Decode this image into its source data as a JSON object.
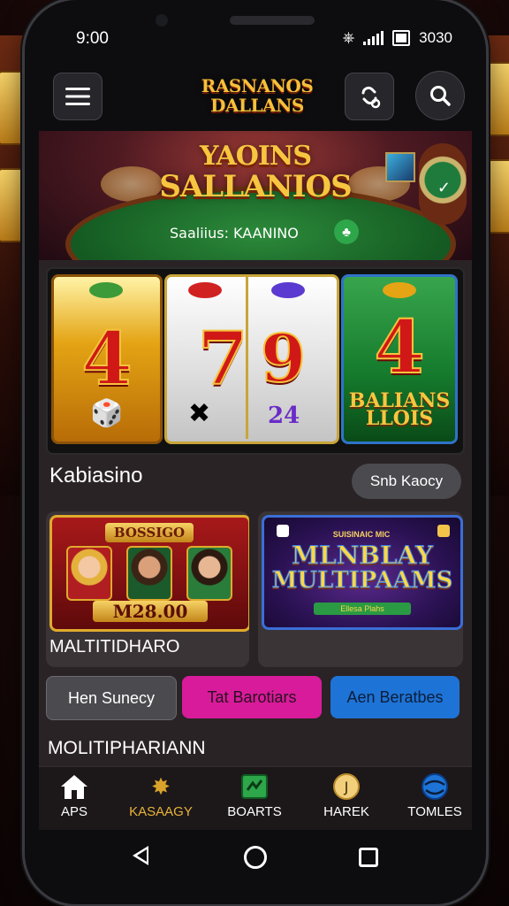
{
  "status": {
    "time": "9:00",
    "right_text": "3030"
  },
  "header": {
    "logo_line1": "RASNANOS",
    "logo_line2": "DALLANS"
  },
  "banner": {
    "title_line1": "YAOINS",
    "title_line2": "SALLANIOS",
    "subtitle": "Saaliius: KAANINO"
  },
  "slots": {
    "reel1": "4",
    "reel2": "7",
    "reel3": "9",
    "reel3_sub": "24",
    "reel4": "4",
    "reel4_label_line1": "BALIANS",
    "reel4_label_line2": "LLOIS"
  },
  "section": {
    "title": "Kabiasino",
    "button": "Snb Kaocy"
  },
  "cards": [
    {
      "badge": "BOSSIGO",
      "amount": "M28.00",
      "label": "MALTITIDHARO"
    },
    {
      "small": "SUISINAIC MIC",
      "line1": "MLNBLAY",
      "line2": "MULTIPAAMS",
      "bar": "Ellesa Plahs"
    }
  ],
  "buttons": [
    "Hen Sunecy",
    "Tat Barotiars",
    "Aen Beratbes"
  ],
  "section2": {
    "title": "MOLITIPHARIANN"
  },
  "tabs": [
    {
      "label": "APS",
      "icon": "home-icon"
    },
    {
      "label": "KASAAGY",
      "icon": "star-icon"
    },
    {
      "label": "BOARTS",
      "icon": "board-icon"
    },
    {
      "label": "HAREK",
      "icon": "coin-icon"
    },
    {
      "label": "TOMLES",
      "icon": "globe-icon"
    }
  ],
  "colors": {
    "accent_gold": "#e8b33a",
    "pink": "#d81b9a",
    "blue": "#1e73d6"
  }
}
